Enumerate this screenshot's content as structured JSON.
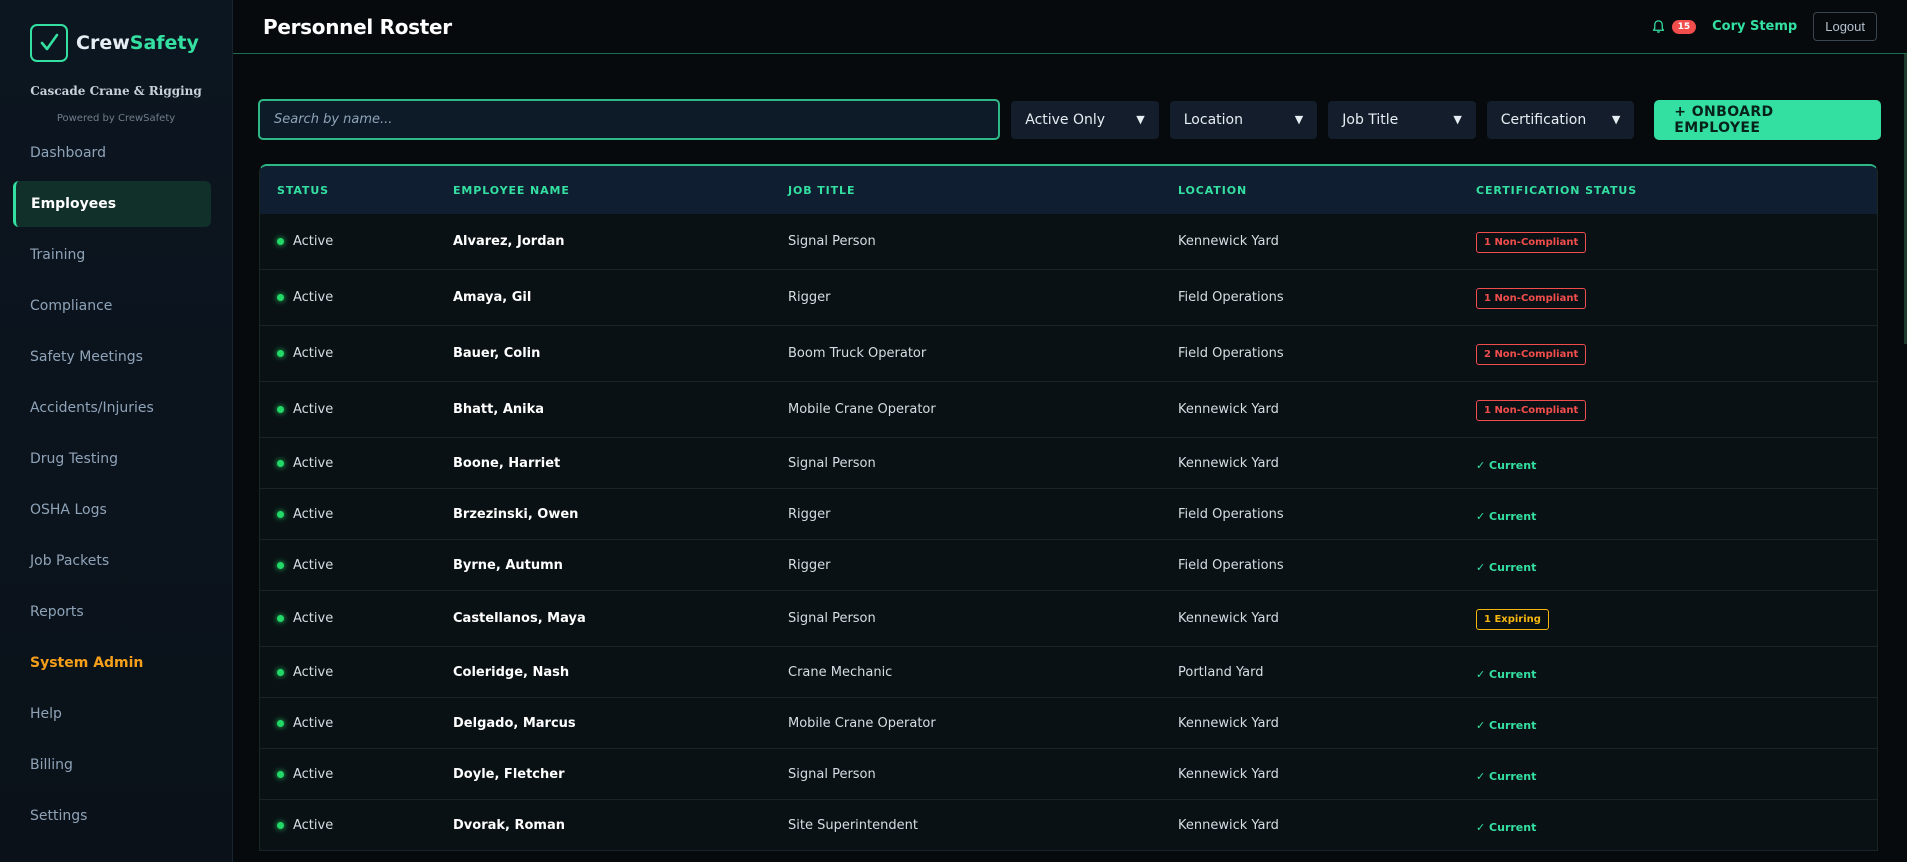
{
  "brand": {
    "name_part1": "Crew",
    "name_part2": "Safety",
    "company": "Cascade Crane & Rigging",
    "powered_by": "Powered by CrewSafety"
  },
  "sidebar": {
    "items": [
      {
        "label": "Dashboard"
      },
      {
        "label": "Employees",
        "active": true
      },
      {
        "label": "Training"
      },
      {
        "label": "Compliance"
      },
      {
        "label": "Safety Meetings"
      },
      {
        "label": "Accidents/Injuries"
      },
      {
        "label": "Drug Testing"
      },
      {
        "label": "OSHA Logs"
      },
      {
        "label": "Job Packets"
      },
      {
        "label": "Reports"
      },
      {
        "label": "System Admin"
      },
      {
        "label": "Help"
      },
      {
        "label": "Billing"
      },
      {
        "label": "Settings"
      }
    ]
  },
  "header": {
    "title": "Personnel Roster",
    "notification_count": "15",
    "user_name": "Cory Stemp",
    "logout_label": "Logout"
  },
  "controls": {
    "search_placeholder": "Search by name...",
    "filters": [
      "Active Only",
      "Location",
      "Job Title",
      "Certification"
    ],
    "onboard_label": "+ ONBOARD EMPLOYEE"
  },
  "table": {
    "headers": [
      "STATUS",
      "EMPLOYEE NAME",
      "JOB TITLE",
      "LOCATION",
      "CERTIFICATION STATUS"
    ],
    "rows": [
      {
        "status": "Active",
        "name": "Alvarez, Jordan",
        "job": "Signal Person",
        "location": "Kennewick Yard",
        "cert": "1 Non-Compliant",
        "cert_type": "red"
      },
      {
        "status": "Active",
        "name": "Amaya, Gil",
        "job": "Rigger",
        "location": "Field Operations",
        "cert": "1 Non-Compliant",
        "cert_type": "red"
      },
      {
        "status": "Active",
        "name": "Bauer, Colin",
        "job": "Boom Truck Operator",
        "location": "Field Operations",
        "cert": "2 Non-Compliant",
        "cert_type": "red"
      },
      {
        "status": "Active",
        "name": "Bhatt, Anika",
        "job": "Mobile Crane Operator",
        "location": "Kennewick Yard",
        "cert": "1 Non-Compliant",
        "cert_type": "red"
      },
      {
        "status": "Active",
        "name": "Boone, Harriet",
        "job": "Signal Person",
        "location": "Kennewick Yard",
        "cert": "✓ Current",
        "cert_type": "green"
      },
      {
        "status": "Active",
        "name": "Brzezinski, Owen",
        "job": "Rigger",
        "location": "Field Operations",
        "cert": "✓ Current",
        "cert_type": "green"
      },
      {
        "status": "Active",
        "name": "Byrne, Autumn",
        "job": "Rigger",
        "location": "Field Operations",
        "cert": "✓ Current",
        "cert_type": "green"
      },
      {
        "status": "Active",
        "name": "Castellanos, Maya",
        "job": "Signal Person",
        "location": "Kennewick Yard",
        "cert": "1 Expiring",
        "cert_type": "amber"
      },
      {
        "status": "Active",
        "name": "Coleridge, Nash",
        "job": "Crane Mechanic",
        "location": "Portland Yard",
        "cert": "✓ Current",
        "cert_type": "green"
      },
      {
        "status": "Active",
        "name": "Delgado, Marcus",
        "job": "Mobile Crane Operator",
        "location": "Kennewick Yard",
        "cert": "✓ Current",
        "cert_type": "green"
      },
      {
        "status": "Active",
        "name": "Doyle, Fletcher",
        "job": "Signal Person",
        "location": "Kennewick Yard",
        "cert": "✓ Current",
        "cert_type": "green"
      },
      {
        "status": "Active",
        "name": "Dvorak, Roman",
        "job": "Site Superintendent",
        "location": "Kennewick Yard",
        "cert": "✓ Current",
        "cert_type": "green"
      }
    ]
  },
  "colors": {
    "accent": "#34e0a1",
    "danger": "#f14d4d",
    "warning": "#f5b60f",
    "admin": "#f59f1a"
  }
}
